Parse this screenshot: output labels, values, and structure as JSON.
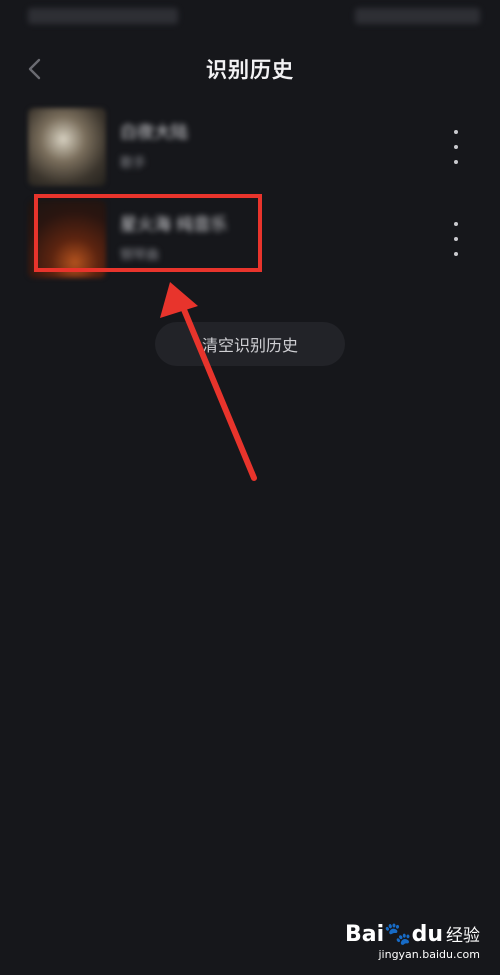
{
  "header": {
    "title": "识别历史",
    "back_icon": "chevron-left-icon"
  },
  "history": [
    {
      "title": "白夜大陆",
      "artist": "歌手",
      "more_icon": "more-vertical-icon"
    },
    {
      "title": "星火海 纯音乐",
      "artist": "钢琴曲",
      "more_icon": "more-vertical-icon"
    }
  ],
  "actions": {
    "clear_label": "清空识别历史"
  },
  "annotation": {
    "color": "#e8342c"
  },
  "watermark": {
    "brand": "Bai",
    "brand2": "du",
    "cn": "经验",
    "url": "jingyan.baidu.com"
  }
}
